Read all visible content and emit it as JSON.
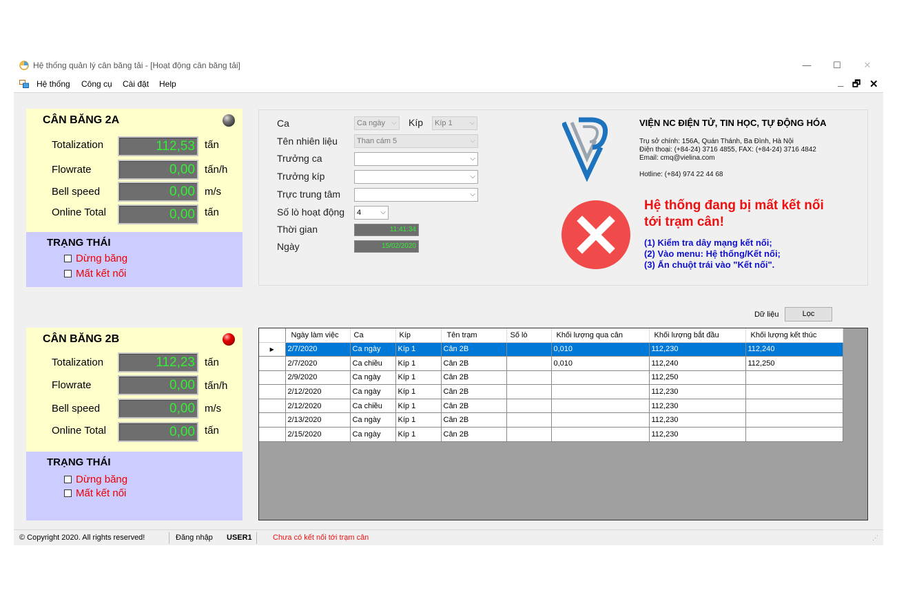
{
  "window": {
    "title": "Hệ thống quản lý cân băng tải - [Hoạt động cân băng tải]",
    "minimize": "—",
    "maximize": "☐",
    "close": "✕"
  },
  "menu": {
    "items": [
      "Hệ thống",
      "Công cụ",
      "Cài đặt",
      "Help"
    ],
    "mdi_minimize": "_",
    "mdi_restore": "🗗",
    "mdi_close": "✕"
  },
  "scales": [
    {
      "name": "CÂN BĂNG 2A",
      "lamp": "gray",
      "rows": [
        {
          "label": "Totalization",
          "value": "112,53",
          "unit": "tấn"
        },
        {
          "label": "Flowrate",
          "value": "0,00",
          "unit": "tấn/h"
        },
        {
          "label": "Bell speed",
          "value": "0,00",
          "unit": "m/s"
        },
        {
          "label": "Online Total",
          "value": "0,00",
          "unit": "tấn"
        }
      ],
      "status_title": "TRẠNG THÁI",
      "status_items": [
        "Dừng băng",
        "Mất kết nối"
      ]
    },
    {
      "name": "CÂN BĂNG 2B",
      "lamp": "red",
      "rows": [
        {
          "label": "Totalization",
          "value": "112,23",
          "unit": "tấn"
        },
        {
          "label": "Flowrate",
          "value": "0,00",
          "unit": "tấn/h"
        },
        {
          "label": "Bell speed",
          "value": "0,00",
          "unit": "m/s"
        },
        {
          "label": "Online Total",
          "value": "0,00",
          "unit": "tấn"
        }
      ],
      "status_title": "TRẠNG THÁI",
      "status_items": [
        "Dừng băng",
        "Mất kết nối"
      ]
    }
  ],
  "form": {
    "shift_label": "Ca",
    "shift_value": "Ca ngày",
    "crew_label": "Kíp",
    "crew_value": "Kíp 1",
    "fuel_label": "Tên nhiên liệu",
    "fuel_value": "Than cám 5",
    "shift_leader_label": "Trưởng ca",
    "shift_leader_value": "",
    "crew_leader_label": "Trưởng kíp",
    "crew_leader_value": "",
    "central_duty_label": "Trực trung tâm",
    "central_duty_value": "",
    "furnace_count_label": "Số lò hoạt động",
    "furnace_count_value": "4",
    "time_label": "Thời gian",
    "time_value": "11:41:34",
    "date_label": "Ngày",
    "date_value": "15/02/2020"
  },
  "org": {
    "name": "VIỆN NC ĐIỆN TỬ, TIN HỌC, TỰ ĐỘNG HÓA",
    "address": "Trụ sở chính: 156A, Quán Thánh, Ba Đình, Hà Nội",
    "phone": "Điện thoại: (+84-24) 3716 4855, FAX: (+84-24) 3716 4842",
    "email": "Email: cmq@vielina.com",
    "hotline": "Hotline: (+84) 974 22 44 68"
  },
  "error": {
    "title": "Hệ thống đang bị mất kết nối tới trạm cân!",
    "steps": [
      "(1) Kiểm tra dây mạng kết nối;",
      "(2) Vào menu: Hệ thống/Kết nối;",
      "(3) Ấn chuột trái vào \"Kết nối\"."
    ]
  },
  "filter": {
    "label": "Dữ liệu",
    "button": "Lọc"
  },
  "grid": {
    "columns": [
      "Ngày làm việc",
      "Ca",
      "Kíp",
      "Tên trạm",
      "Số lò",
      "Khối lượng qua cân",
      "Khối lượng bắt đầu",
      "Khối lượng kết thúc"
    ],
    "selected_marker": "▶",
    "rows": [
      [
        "2/7/2020",
        "Ca ngày",
        "Kíp 1",
        "Cân 2B",
        "",
        "0,010",
        "112,230",
        "112,240"
      ],
      [
        "2/7/2020",
        "Ca chiều",
        "Kíp 1",
        "Cân 2B",
        "",
        "0,010",
        "112,240",
        "112,250"
      ],
      [
        "2/9/2020",
        "Ca ngày",
        "Kíp 1",
        "Cân 2B",
        "",
        "",
        "112,250",
        ""
      ],
      [
        "2/12/2020",
        "Ca ngày",
        "Kíp 1",
        "Cân 2B",
        "",
        "",
        "112,230",
        ""
      ],
      [
        "2/12/2020",
        "Ca chiều",
        "Kíp 1",
        "Cân 2B",
        "",
        "",
        "112,230",
        ""
      ],
      [
        "2/13/2020",
        "Ca ngày",
        "Kíp 1",
        "Cân 2B",
        "",
        "",
        "112,230",
        ""
      ],
      [
        "2/15/2020",
        "Ca ngày",
        "Kíp 1",
        "Cân 2B",
        "",
        "",
        "112,230",
        ""
      ]
    ]
  },
  "statusbar": {
    "copyright": "© Copyright 2020. All rights reserved!",
    "login_label": "Đăng nhập",
    "user": "USER1",
    "connection": "Chưa có kết nối tới trạm cân"
  },
  "colors": {
    "scale_panel": "#ffffcc",
    "status_panel": "#ccccff",
    "lcd_text": "#33ee33",
    "error_red": "#ee1111",
    "steps_blue": "#1111cc",
    "selection": "#0078d7"
  }
}
